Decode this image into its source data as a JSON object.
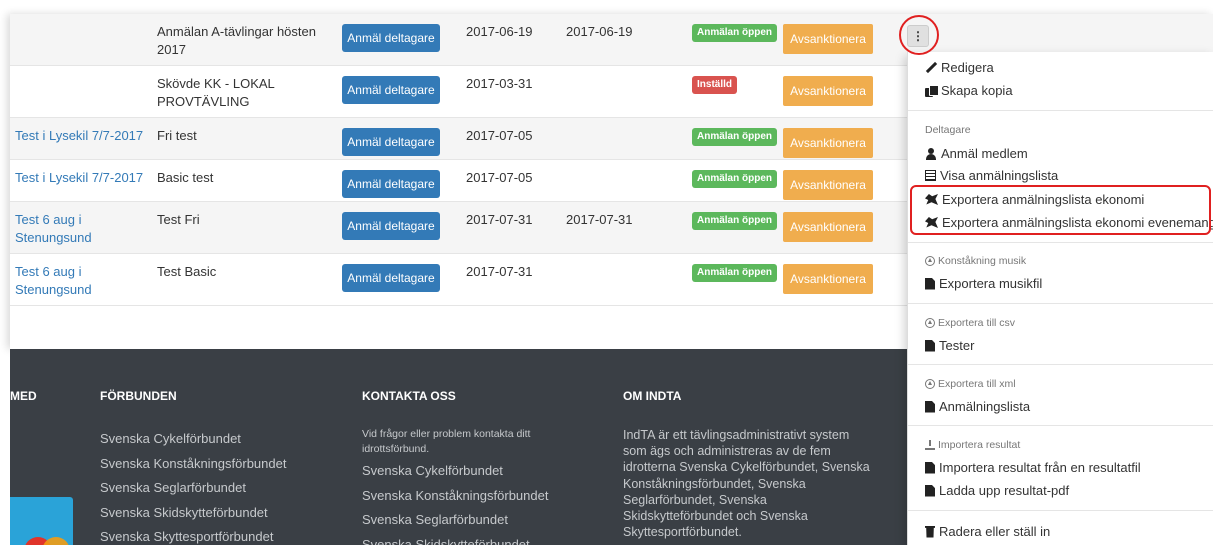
{
  "rows": [
    {
      "competition": "",
      "name": "Anmälan A-tävlingar hösten 2017",
      "button": "Anmäl deltagare",
      "date1": "2017-06-19",
      "date2": "2017-06-19",
      "status": "Anmälan öppen",
      "status_type": "open",
      "sanction": "Avsanktionera"
    },
    {
      "competition": "",
      "name": "Skövde KK - LOKAL PROVTÄVLING",
      "button": "Anmäl deltagare",
      "date1": "2017-03-31",
      "date2": "",
      "status": "Inställd",
      "status_type": "cancel",
      "sanction": "Avsanktionera"
    },
    {
      "competition": "Test i Lysekil 7/7-2017",
      "name": "Fri test",
      "button": "Anmäl deltagare",
      "date1": "2017-07-05",
      "date2": "",
      "status": "Anmälan öppen",
      "status_type": "open",
      "sanction": "Avsanktionera"
    },
    {
      "competition": "Test i Lysekil 7/7-2017",
      "name": "Basic test",
      "button": "Anmäl deltagare",
      "date1": "2017-07-05",
      "date2": "",
      "status": "Anmälan öppen",
      "status_type": "open",
      "sanction": "Avsanktionera"
    },
    {
      "competition": "Test 6 aug i Stenungsund",
      "name": "Test Fri",
      "button": "Anmäl deltagare",
      "date1": "2017-07-31",
      "date2": "2017-07-31",
      "status": "Anmälan öppen",
      "status_type": "open",
      "sanction": "Avsanktionera"
    },
    {
      "competition": "Test 6 aug i Stenungsund",
      "name": "Test Basic",
      "button": "Anmäl deltagare",
      "date1": "2017-07-31",
      "date2": "",
      "status": "Anmälan öppen",
      "status_type": "open",
      "sanction": "Avsanktionera"
    }
  ],
  "kebab_label": "⋮",
  "menu": {
    "edit": "Redigera",
    "copy": "Skapa kopia",
    "participants_header": "Deltagare",
    "register_member": "Anmäl medlem",
    "show_list": "Visa anmälningslista",
    "export_economy": "Exportera anmälningslista ekonomi",
    "export_economy_event": "Exportera anmälningslista ekonomi evenemang",
    "music_header": "Konståkning musik",
    "export_music": "Exportera musikfil",
    "csv_header": "Exportera till csv",
    "tests": "Tester",
    "xml_header": "Exportera till xml",
    "reg_list": "Anmälningslista",
    "import_header": "Importera resultat",
    "import_results": "Importera resultat från en resultatfil",
    "upload_pdf": "Ladda upp resultat-pdf",
    "delete": "Radera eller ställ in"
  },
  "footer": {
    "col0_head": "MED",
    "col1_head": "FÖRBUNDEN",
    "col1_links": [
      "Svenska Cykelförbundet",
      "Svenska Konståkningsförbundet",
      "Svenska Seglarförbundet",
      "Svenska Skidskytteförbundet",
      "Svenska Skyttesportförbundet"
    ],
    "col2_head": "KONTAKTA OSS",
    "col2_intro": "Vid frågor eller problem kontakta ditt idrottsförbund.",
    "col2_links": [
      "Svenska Cykelförbundet",
      "Svenska Konståkningsförbundet",
      "Svenska Seglarförbundet",
      "Svenska Skidskytteförbundet"
    ],
    "col3_head": "OM INDTA",
    "col3_text": "IndTA är ett tävlingsadministrativt system som ägs och administreras av de fem idrotterna Svenska Cykelförbundet, Svenska Konståkningsförbundet, Svenska Seglarförbundet, Svenska Skidskytteförbundet och Svenska Skyttesportförbundet."
  },
  "colors": {
    "primary": "#337ab7",
    "warning": "#f0ad4e",
    "success": "#5cb85c",
    "danger": "#d9534f",
    "footer": "#3a3f45",
    "highlight": "#e02020"
  }
}
